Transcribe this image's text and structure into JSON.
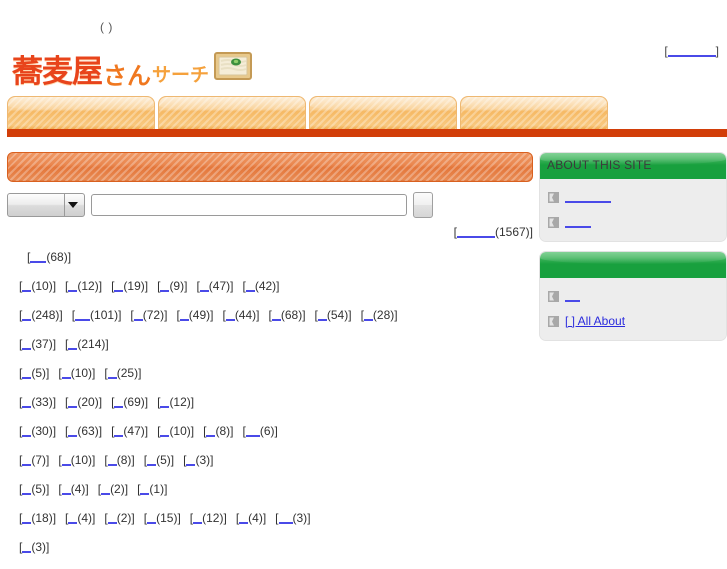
{
  "page": {
    "tagline": "(                         )",
    "top_right_link": {
      "open_bracket": "[",
      "label": "",
      "label_width": 48,
      "close_bracket": "]"
    }
  },
  "logo": {
    "main": "蕎麦屋",
    "sub1": "さん",
    "sub2": "サーチ",
    "icon": "soba-tray-icon"
  },
  "tabs": [
    {
      "label": "",
      "name": "tab-1"
    },
    {
      "label": "",
      "name": "tab-2"
    },
    {
      "label": "",
      "name": "tab-3"
    },
    {
      "label": "",
      "name": "tab-4"
    }
  ],
  "section": {
    "header_label": ""
  },
  "search": {
    "select_value": "",
    "select_options": [
      ""
    ],
    "input_value": "",
    "input_placeholder": "",
    "button_label": ""
  },
  "total": {
    "open_bracket": "[",
    "link_label": "",
    "link_width": 38,
    "count": "(1567)",
    "close_bracket": "]"
  },
  "area_rows": [
    {
      "indent": true,
      "items": [
        {
          "count": "(68)",
          "width": 16
        }
      ]
    },
    {
      "indent": false,
      "items": [
        {
          "count": "(10)",
          "width": 9
        },
        {
          "count": "(12)",
          "width": 9
        },
        {
          "count": "(19)",
          "width": 9
        },
        {
          "count": "(9)",
          "width": 9
        },
        {
          "count": "(47)",
          "width": 9
        },
        {
          "count": "(42)",
          "width": 9
        }
      ]
    },
    {
      "indent": false,
      "items": [
        {
          "count": "(248)",
          "width": 9
        },
        {
          "count": "(101)",
          "width": 15
        },
        {
          "count": "(72)",
          "width": 9
        },
        {
          "count": "(49)",
          "width": 9
        },
        {
          "count": "(44)",
          "width": 9
        },
        {
          "count": "(68)",
          "width": 9
        },
        {
          "count": "(54)",
          "width": 9
        },
        {
          "count": "(28)",
          "width": 9
        }
      ]
    },
    {
      "indent": false,
      "items": [
        {
          "count": "(37)",
          "width": 9
        },
        {
          "count": "(214)",
          "width": 9
        }
      ]
    },
    {
      "indent": false,
      "items": [
        {
          "count": "(5)",
          "width": 9
        },
        {
          "count": "(10)",
          "width": 9
        },
        {
          "count": "(25)",
          "width": 9
        }
      ]
    },
    {
      "indent": false,
      "items": [
        {
          "count": "(33)",
          "width": 9
        },
        {
          "count": "(20)",
          "width": 9
        },
        {
          "count": "(69)",
          "width": 9
        },
        {
          "count": "(12)",
          "width": 9
        }
      ]
    },
    {
      "indent": false,
      "items": [
        {
          "count": "(30)",
          "width": 9
        },
        {
          "count": "(63)",
          "width": 9
        },
        {
          "count": "(47)",
          "width": 9
        },
        {
          "count": "(10)",
          "width": 9
        },
        {
          "count": "(8)",
          "width": 9
        },
        {
          "count": "(6)",
          "width": 14
        }
      ]
    },
    {
      "indent": false,
      "items": [
        {
          "count": "(7)",
          "width": 9
        },
        {
          "count": "(10)",
          "width": 9
        },
        {
          "count": "(8)",
          "width": 9
        },
        {
          "count": "(5)",
          "width": 9
        },
        {
          "count": "(3)",
          "width": 9
        }
      ]
    },
    {
      "indent": false,
      "items": [
        {
          "count": "(5)",
          "width": 9
        },
        {
          "count": "(4)",
          "width": 9
        },
        {
          "count": "(2)",
          "width": 9
        },
        {
          "count": "(1)",
          "width": 9
        }
      ]
    },
    {
      "indent": false,
      "items": [
        {
          "count": "(18)",
          "width": 9
        },
        {
          "count": "(4)",
          "width": 9
        },
        {
          "count": "(2)",
          "width": 9
        },
        {
          "count": "(15)",
          "width": 9
        },
        {
          "count": "(12)",
          "width": 9
        },
        {
          "count": "(4)",
          "width": 9
        },
        {
          "count": "(3)",
          "width": 14
        }
      ]
    },
    {
      "indent": false,
      "items": [
        {
          "count": "(3)",
          "width": 9
        }
      ]
    }
  ],
  "sidebar": {
    "boxes": [
      {
        "title": "ABOUT THIS SITE",
        "name": "sidebar-box-about-this-site",
        "links": [
          {
            "label": "",
            "width": 46,
            "bullet": "arrow-bullet-icon"
          },
          {
            "label": "",
            "width": 26,
            "bullet": "arrow-bullet-icon"
          }
        ]
      },
      {
        "title": "",
        "name": "sidebar-box-secondary",
        "links": [
          {
            "label": "",
            "width": 15,
            "bullet": "arrow-bullet-icon"
          },
          {
            "label": "[ ] All About",
            "width": 0,
            "bullet": "arrow-bullet-icon"
          }
        ]
      }
    ]
  },
  "colors": {
    "brand_orange": "#e8441b",
    "tab_orange": "#f6b964",
    "tab_underline": "#d23e09",
    "section_header": "#e4763a",
    "sidebar_green": "#18a03e",
    "link_blue": "#2b2bdd",
    "sidebar_bg": "#ededed"
  }
}
